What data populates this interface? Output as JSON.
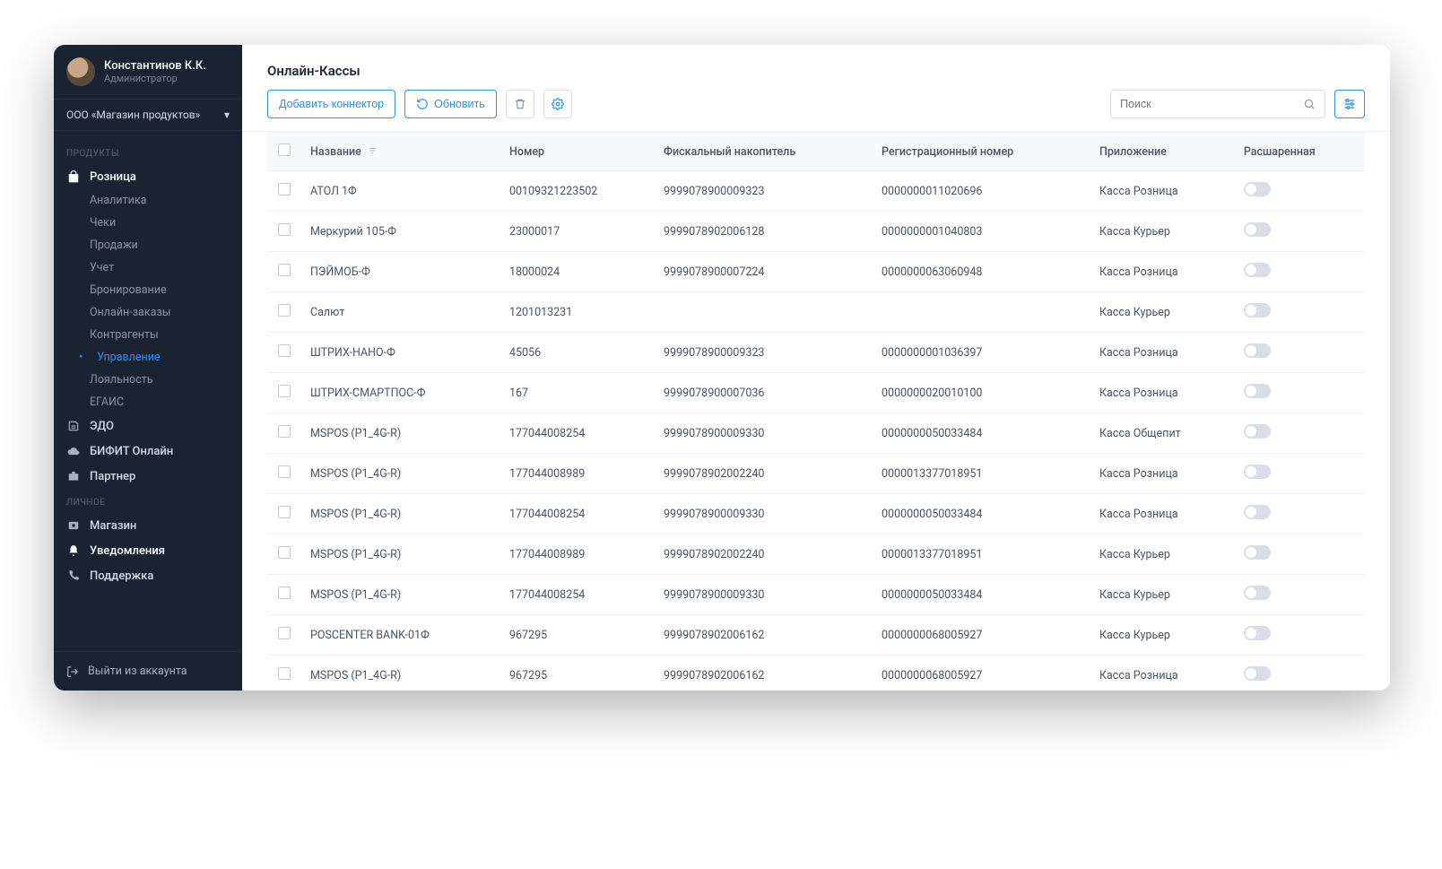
{
  "profile": {
    "name": "Константинов К.К.",
    "role": "Администратор"
  },
  "org": {
    "name": "ООО «Магазин продуктов»"
  },
  "sections": {
    "products": "ПРОДУКТЫ",
    "personal": "ЛИЧНОЕ"
  },
  "nav": {
    "retail": "Розница",
    "retail_sub": [
      "Аналитика",
      "Чеки",
      "Продажи",
      "Учет",
      "Бронирование",
      "Онлайн-заказы",
      "Контрагенты",
      "Управление",
      "Лояльность",
      "ЕГАИС"
    ],
    "edo": "ЭДО",
    "bifit": "БИФИТ Онлайн",
    "partner": "Партнер",
    "store": "Магазин",
    "notifications": "Уведомления",
    "support": "Поддержка"
  },
  "logout": "Выйти из аккаунта",
  "page": {
    "title": "Онлайн-Кассы"
  },
  "toolbar": {
    "add": "Добавить коннектор",
    "refresh": "Обновить",
    "search_placeholder": "Поиск"
  },
  "columns": {
    "name": "Название",
    "number": "Номер",
    "fiscal": "Фискальный накопитель",
    "reg": "Регистрационный номер",
    "app": "Приложение",
    "shared": "Расшаренная"
  },
  "rows": [
    {
      "name": "АТОЛ 1Ф",
      "number": "00109321223502",
      "fiscal": "9999078900009323",
      "reg": "0000000011020696",
      "app": "Касса Розница"
    },
    {
      "name": "Меркурий 105-Ф",
      "number": "23000017",
      "fiscal": "9999078902006128",
      "reg": "0000000001040803",
      "app": "Касса Курьер"
    },
    {
      "name": "ПЭЙМОБ-Ф",
      "number": "18000024",
      "fiscal": "9999078900007224",
      "reg": "0000000063060948",
      "app": "Касса Розница"
    },
    {
      "name": "Салют",
      "number": "1201013231",
      "fiscal": "",
      "reg": "",
      "app": "Касса Курьер"
    },
    {
      "name": "ШТРИХ-НАНО-Ф",
      "number": "45056",
      "fiscal": "9999078900009323",
      "reg": "0000000001036397",
      "app": "Касса Розница"
    },
    {
      "name": "ШТРИХ-СМАРТПОС-Ф",
      "number": "167",
      "fiscal": "9999078900007036",
      "reg": "0000000020010100",
      "app": "Касса Розница"
    },
    {
      "name": "MSPOS (P1_4G-R)",
      "number": "177044008254",
      "fiscal": "9999078900009330",
      "reg": "0000000050033484",
      "app": "Касса Общепит"
    },
    {
      "name": "MSPOS (P1_4G-R)",
      "number": "177044008989",
      "fiscal": "9999078902002240",
      "reg": "0000013377018951",
      "app": "Касса Розница"
    },
    {
      "name": "MSPOS (P1_4G-R)",
      "number": "177044008254",
      "fiscal": "9999078900009330",
      "reg": "0000000050033484",
      "app": "Касса Розница"
    },
    {
      "name": "MSPOS (P1_4G-R)",
      "number": "177044008989",
      "fiscal": "9999078902002240",
      "reg": "0000013377018951",
      "app": "Касса Курьер"
    },
    {
      "name": "MSPOS (P1_4G-R)",
      "number": "177044008254",
      "fiscal": "9999078900009330",
      "reg": "0000000050033484",
      "app": "Касса Курьер"
    },
    {
      "name": "POSCENTER BANK-01Ф",
      "number": "967295",
      "fiscal": "9999078902006162",
      "reg": "0000000068005927",
      "app": "Касса Курьер"
    },
    {
      "name": "MSPOS (P1_4G-R)",
      "number": "967295",
      "fiscal": "9999078902006162",
      "reg": "0000000068005927",
      "app": "Касса Розница"
    }
  ]
}
